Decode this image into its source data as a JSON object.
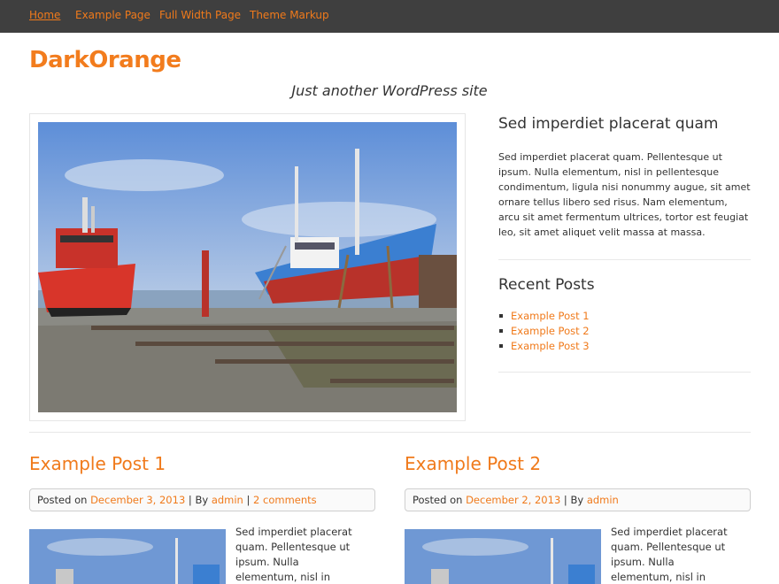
{
  "nav": {
    "items": [
      {
        "label": "Home",
        "active": true
      },
      {
        "label": "Example Page",
        "active": false
      },
      {
        "label": "Full Width Page",
        "active": false
      },
      {
        "label": "Theme Markup",
        "active": false
      }
    ]
  },
  "site": {
    "title": "DarkOrange",
    "tagline": "Just another WordPress site"
  },
  "sidebar": {
    "text_widget": {
      "title": "Sed imperdiet placerat quam",
      "body": "Sed imperdiet placerat quam. Pellentesque ut ipsum. Nulla elementum, nisl in pellentesque condimentum, ligula nisi nonummy augue, sit amet ornare tellus libero sed risus. Nam elementum, arcu sit amet fermentum ultrices, tortor est feugiat leo, sit amet aliquet velit massa at massa."
    },
    "recent_posts": {
      "title": "Recent Posts",
      "items": [
        "Example Post 1",
        "Example Post 2",
        "Example Post 3"
      ]
    }
  },
  "posts": [
    {
      "title": "Example Post 1",
      "posted_on_label": "Posted on",
      "date": "December 3, 2013",
      "sep1": "|",
      "by_label": "By",
      "author": "admin",
      "sep2": "|",
      "comments": "2 comments",
      "excerpt": "Sed imperdiet placerat quam. Pellentesque ut ipsum. Nulla elementum, nisl in pellentesque"
    },
    {
      "title": "Example Post 2",
      "posted_on_label": "Posted on",
      "date": "December 2, 2013",
      "sep1": "|",
      "by_label": "By",
      "author": "admin",
      "excerpt": "Sed imperdiet placerat quam. Pellentesque ut ipsum. Nulla elementum, nisl in pellentesque"
    }
  ],
  "colors": {
    "accent": "#f07a1b",
    "nav_bg": "#3f3f3f"
  }
}
